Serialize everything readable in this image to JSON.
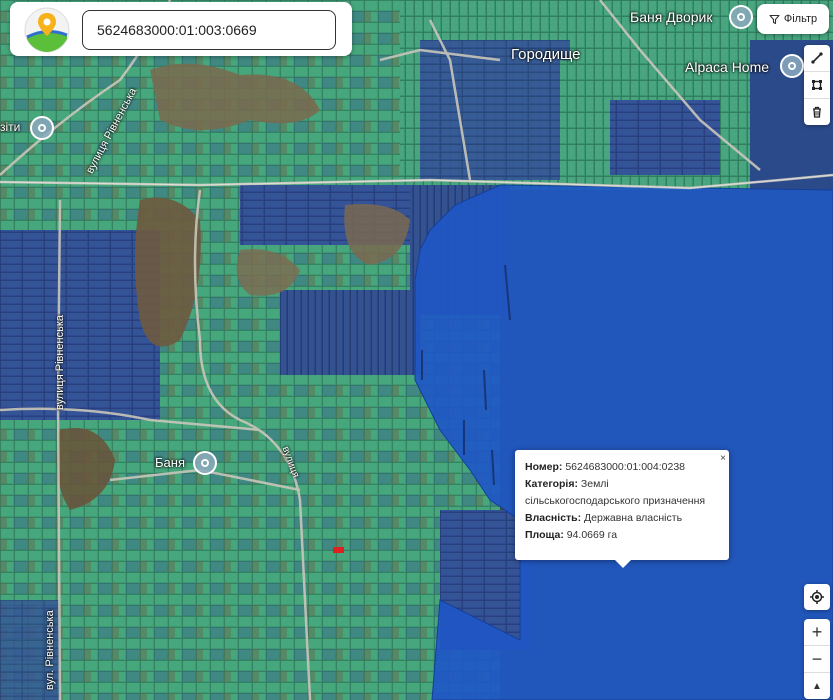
{
  "search": {
    "value": "5624683000:01:003:0669"
  },
  "filter": {
    "label": "Фільтр",
    "icon": "filter-icon"
  },
  "tools": [
    {
      "name": "draw-line-icon"
    },
    {
      "name": "draw-polygon-icon"
    },
    {
      "name": "trash-icon"
    }
  ],
  "controls": {
    "locate": "locate-icon",
    "zoom_in": "+",
    "zoom_out": "−",
    "north": "▲"
  },
  "map_labels": {
    "village": "Городище",
    "bath_top": "Баня Дворик",
    "alpaca": "Alpaca Home",
    "bath_mid": "Баня",
    "street_1": "вулиця Рівненська",
    "street_2": "вулиця Рівненська",
    "street_3": "вул. Рівненська",
    "street_4": "вулиця",
    "poi_left": "зіти"
  },
  "popup": {
    "close": "×",
    "number_label": "Номер:",
    "number_value": "5624683000:01:004:0238",
    "category_label": "Категорія:",
    "category_value": "Землі сільськогосподарського призначення",
    "ownership_label": "Власність:",
    "ownership_value": "Державна власність",
    "area_label": "Площа:",
    "area_value": "94.0669 га"
  },
  "colors": {
    "private_parcel": "#3f9f78",
    "state_parcel": "#2f4f95",
    "selected_parcel": "#1f56c8",
    "highlight": "#e02020"
  }
}
